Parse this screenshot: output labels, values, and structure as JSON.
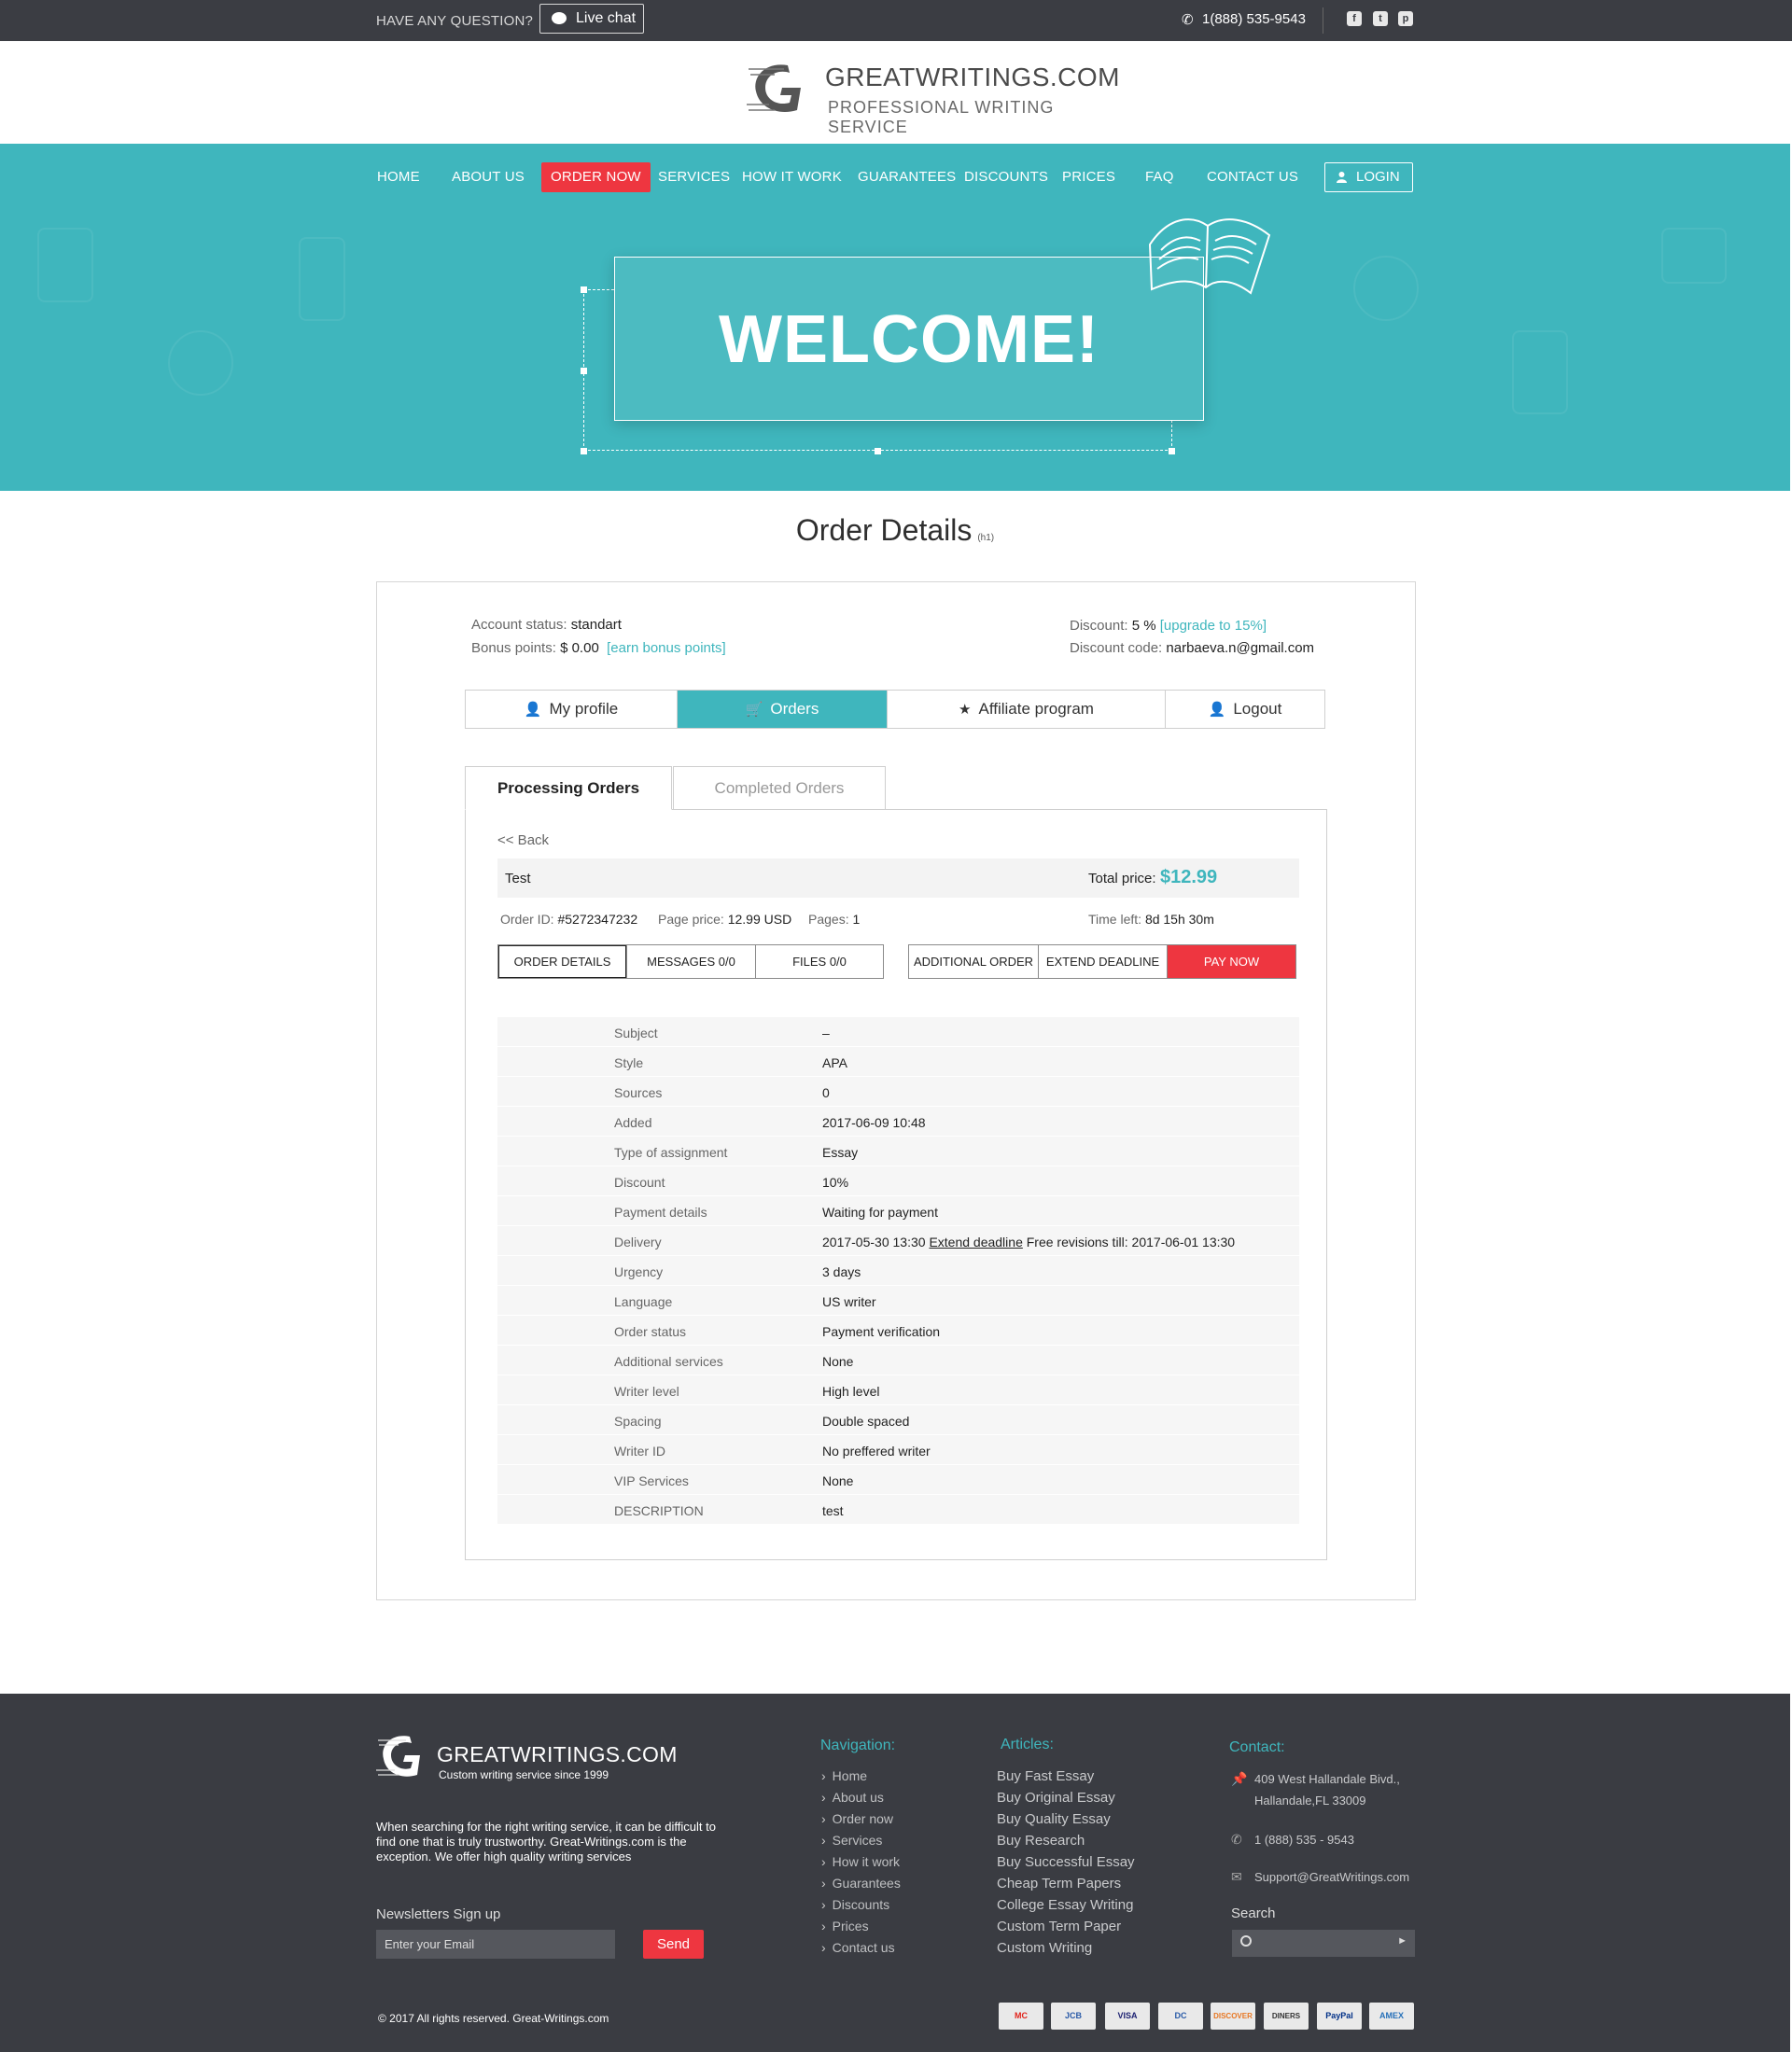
{
  "topbar": {
    "question": "HAVE ANY QUESTION?",
    "live_chat": "Live chat",
    "phone": "1(888) 535-9543",
    "social": [
      "facebook-icon",
      "twitter-icon",
      "pinterest-icon"
    ]
  },
  "brand": {
    "title": "GREATWRITINGS.COM",
    "subtitle": "PROFESSIONAL WRITING SERVICE"
  },
  "colors": {
    "accent": "#3fb6bd",
    "danger": "#ee3640",
    "dark": "#3a3c42"
  },
  "nav": {
    "items": [
      "HOME",
      "ABOUT US",
      "ORDER NOW",
      "SERVICES",
      "HOW IT  WORK",
      "GUARANTEES",
      "DISCOUNTS",
      "PRICES",
      "FAQ",
      "CONTACT US"
    ],
    "active": "ORDER NOW",
    "login": "LOGIN"
  },
  "hero": {
    "title": "WELCOME!"
  },
  "page": {
    "title": "Order Details",
    "title_tag": "(h1)"
  },
  "account": {
    "status_label": "Account status:",
    "status_value": "standart",
    "bonus_label": "Bonus points:",
    "bonus_value": "$ 0.00",
    "bonus_link": "[earn bonus points]",
    "discount_label": "Discount:",
    "discount_value": "5 %",
    "discount_link": "[upgrade to 15%]",
    "code_label": "Discount code:",
    "code_value": "narbaeva.n@gmail.com"
  },
  "account_tabs": [
    "My profile",
    "Orders",
    "Affiliate program",
    "Logout"
  ],
  "order_tabs": [
    "Processing Orders",
    "Completed Orders"
  ],
  "order": {
    "back": "<< Back",
    "name": "Test",
    "total_label": "Total price:",
    "total_value": "$12.99",
    "id_label": "Order ID:",
    "id_value": "#5272347232",
    "page_price_label": "Page price:",
    "page_price_value": "12.99 USD",
    "pages_label": "Pages:",
    "pages_value": "1",
    "time_left_label": "Time left:",
    "time_left_value": "8d 15h 30m",
    "buttons_left": [
      "ORDER DETAILS",
      "MESSAGES 0/0",
      "FILES 0/0"
    ],
    "buttons_right": [
      "ADDITIONAL ORDER",
      "EXTEND DEADLINE",
      "PAY NOW"
    ]
  },
  "details": [
    {
      "k": "Subject",
      "v": "–"
    },
    {
      "k": "Style",
      "v": " APA"
    },
    {
      "k": "Sources",
      "v": "0"
    },
    {
      "k": "Added",
      "v": "2017-06-09 10:48"
    },
    {
      "k": "Type of assignment",
      "v": "Essay"
    },
    {
      "k": "Discount",
      "v": "10%"
    },
    {
      "k": "Payment details",
      "v": "Waiting for payment"
    },
    {
      "k": "Delivery",
      "v": "2017-05-30 13:30",
      "link": "Extend deadline",
      "extra": "Free revisions till: 2017-06-01 13:30"
    },
    {
      "k": "Urgency",
      "v": "3 days"
    },
    {
      "k": "Language",
      "v": "US writer"
    },
    {
      "k": "Order status",
      "v": "Payment verification"
    },
    {
      "k": "Additional services",
      "v": "None"
    },
    {
      "k": "Writer level",
      "v": "High level"
    },
    {
      "k": "Spacing",
      "v": "Double spaced"
    },
    {
      "k": "Writer ID",
      "v": "No preffered writer"
    },
    {
      "k": "VIP Services",
      "v": "None"
    },
    {
      "k": "DESCRIPTION",
      "v": "test"
    }
  ],
  "footer": {
    "brand": "GREATWRITINGS.COM",
    "tagline": "Custom writing service since 1999",
    "about": "When searching for the right writing service, it can be difficult to find one that is truly trustworthy. Great-Writings.com is the exception. We offer high quality writing services",
    "newsletter_label": "Newsletters Sign up",
    "email_placeholder": "Enter your Email",
    "send": "Send",
    "nav_title": "Navigation:",
    "nav": [
      "Home",
      "About us",
      "Order now",
      "Services",
      "How it  work",
      "Guarantees",
      "Discounts",
      "Prices",
      "Contact us"
    ],
    "articles_title": "Articles:",
    "articles": [
      "Buy Fast Essay",
      "Buy Original Essay",
      "Buy Quality Essay",
      "Buy Research",
      "Buy Successful Essay",
      "Cheap Term Papers",
      "College Essay Writing",
      "Custom Term Paper",
      "Custom Writing"
    ],
    "contact_title": "Contact:",
    "address_1": "409 West Hallandale Bivd.,",
    "address_2": "Hallandale,FL 33009",
    "phone": "1 (888) 535 - 9543",
    "email": "Support@GreatWritings.com",
    "search_label": "Search",
    "copyright": "© 2017 All rights reserved. Great-Writings.com",
    "payments": [
      "mastercard-icon",
      "jcb-icon",
      "visa-icon",
      "diners-icon",
      "discover-icon",
      "diners-club-icon",
      "paypal-icon",
      "amex-icon"
    ],
    "payment_labels": [
      "MC",
      "JCB",
      "VISA",
      "DC",
      "DISCOVER",
      "DINERS",
      "PayPal",
      "AMEX"
    ]
  }
}
